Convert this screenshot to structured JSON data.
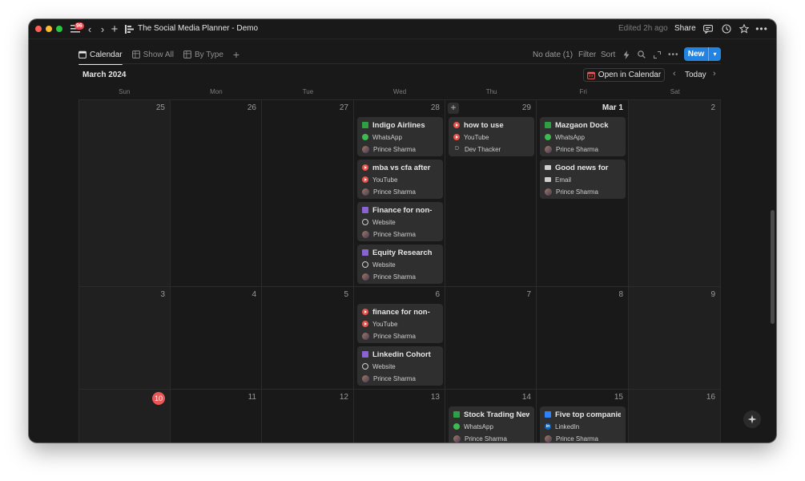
{
  "titlebar": {
    "notification_count": "96",
    "title": "The Social Media Planner - Demo",
    "edited": "Edited 2h ago",
    "share_label": "Share"
  },
  "tabs": [
    {
      "label": "Calendar",
      "icon": "calendar-icon",
      "active": true
    },
    {
      "label": "Show All",
      "icon": "table-icon",
      "active": false
    },
    {
      "label": "By Type",
      "icon": "table-icon",
      "active": false
    }
  ],
  "toolbar": {
    "no_date": "No date (1)",
    "filter": "Filter",
    "sort": "Sort",
    "new_label": "New",
    "accent_color": "#2383e2"
  },
  "calendar": {
    "month_label": "March 2024",
    "open_in_calendar": "Open in Calendar",
    "today_label": "Today",
    "weekdays": [
      "Sun",
      "Mon",
      "Tue",
      "Wed",
      "Thu",
      "Fri",
      "Sat"
    ],
    "weeks": [
      {
        "days": [
          {
            "num": "25",
            "cards": []
          },
          {
            "num": "26",
            "cards": []
          },
          {
            "num": "27",
            "cards": []
          },
          {
            "num": "28",
            "cards": [
              {
                "title": "Indigo Airlines",
                "title_icon": "square-green",
                "channel": "WhatsApp",
                "channel_icon": "green-dot",
                "owner": "Prince Sharma",
                "owner_avatar": "photo"
              },
              {
                "title": "mba vs cfa after",
                "title_icon": "youtube",
                "channel": "YouTube",
                "channel_icon": "youtube",
                "owner": "Prince Sharma",
                "owner_avatar": "photo"
              },
              {
                "title": "Finance for non-",
                "title_icon": "square-purple",
                "channel": "Website",
                "channel_icon": "globe",
                "owner": "Prince Sharma",
                "owner_avatar": "photo"
              },
              {
                "title": "Equity Research",
                "title_icon": "square-purple",
                "channel": "Website",
                "channel_icon": "globe",
                "owner": "Prince Sharma",
                "owner_avatar": "photo"
              }
            ]
          },
          {
            "num": "29",
            "show_add": true,
            "cards": [
              {
                "title": "how to use",
                "title_icon": "youtube",
                "channel": "YouTube",
                "channel_icon": "youtube",
                "owner": "Dev Thacker",
                "owner_avatar": "D"
              }
            ]
          },
          {
            "num": "Mar 1",
            "month_first": true,
            "cards": [
              {
                "title": "Mazgaon Dock",
                "title_icon": "square-green",
                "channel": "WhatsApp",
                "channel_icon": "green-dot",
                "owner": "Prince Sharma",
                "owner_avatar": "photo"
              },
              {
                "title": "Good news for",
                "title_icon": "mail",
                "channel": "Email",
                "channel_icon": "mail",
                "owner": "Prince Sharma",
                "owner_avatar": "photo"
              }
            ]
          },
          {
            "num": "2",
            "cards": []
          }
        ]
      },
      {
        "days": [
          {
            "num": "3",
            "cards": []
          },
          {
            "num": "4",
            "cards": []
          },
          {
            "num": "5",
            "cards": []
          },
          {
            "num": "6",
            "cards": [
              {
                "title": "finance for non-",
                "title_icon": "youtube",
                "channel": "YouTube",
                "channel_icon": "youtube",
                "owner": "Prince Sharma",
                "owner_avatar": "photo"
              },
              {
                "title": "Linkedin Cohort",
                "title_icon": "square-purple",
                "channel": "Website",
                "channel_icon": "globe",
                "owner": "Prince Sharma",
                "owner_avatar": "photo"
              }
            ]
          },
          {
            "num": "7",
            "cards": []
          },
          {
            "num": "8",
            "cards": []
          },
          {
            "num": "9",
            "cards": []
          }
        ]
      },
      {
        "days": [
          {
            "num": "10",
            "is_today": true,
            "cards": []
          },
          {
            "num": "11",
            "cards": []
          },
          {
            "num": "12",
            "cards": []
          },
          {
            "num": "13",
            "cards": []
          },
          {
            "num": "14",
            "cards": [
              {
                "title": "Stock Trading News",
                "title_icon": "square-green",
                "channel": "WhatsApp",
                "channel_icon": "green-dot",
                "owner": "Prince Sharma",
                "owner_avatar": "photo"
              }
            ]
          },
          {
            "num": "15",
            "cards": [
              {
                "title": "Five top companies",
                "title_icon": "cal-blue",
                "channel": "LinkedIn",
                "channel_icon": "linkedin",
                "owner": "Prince Sharma",
                "owner_avatar": "photo"
              }
            ]
          },
          {
            "num": "16",
            "cards": []
          }
        ]
      }
    ]
  },
  "colors": {
    "background": "#191919",
    "card": "#2f2f2f",
    "today_marker": "#eb5757"
  }
}
